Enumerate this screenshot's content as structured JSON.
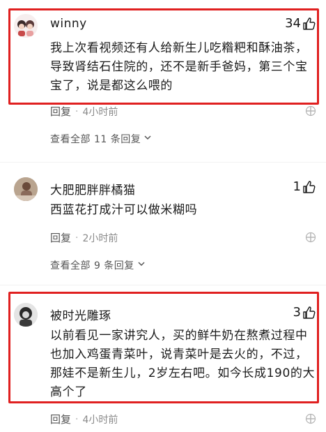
{
  "comments": [
    {
      "username": "winny",
      "likes": "34",
      "text_lines": [
        "我上次看视频还有人给新生儿吃糌粑和酥油茶，",
        "导致肾结石住院的，还不是新手爸妈，第三个宝",
        "宝了，说是都这么喂的"
      ],
      "reply_label": "回复",
      "time": "4小时前",
      "view_all": "查看全部 11 条回复"
    },
    {
      "username": "大肥肥胖胖橘猫",
      "likes": "1",
      "text_lines": [
        "西蓝花打成汁可以做米糊吗"
      ],
      "reply_label": "回复",
      "time": "2小时前",
      "view_all": "查看全部 9 条回复"
    },
    {
      "username": "被时光雕琢",
      "likes": "3",
      "text_lines": [
        "以前看见一家讲究人，买的鲜牛奶在熬煮过程中",
        "也加入鸡蛋青菜叶，说青菜叶是去火的，不过，",
        "那娃不是新生儿，2岁左右吧。如今长成190的大",
        "高个了"
      ],
      "reply_label": "回复",
      "time": "4小时前"
    }
  ],
  "dot": "·",
  "colors": {
    "highlight": "#e02020",
    "meta": "#8a8a8a",
    "text": "#1a1a1a"
  },
  "icons": [
    "thumbs-up-icon",
    "chevron-down-icon",
    "more-icon",
    "avatar"
  ]
}
